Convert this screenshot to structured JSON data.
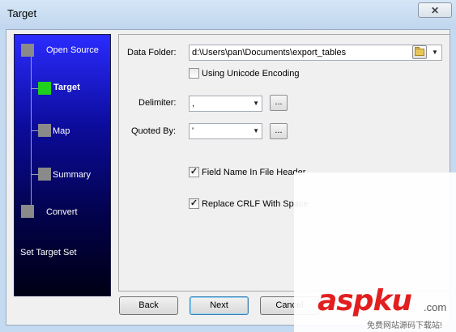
{
  "window": {
    "title": "Target",
    "close_glyph": "✕"
  },
  "wizard": {
    "steps": [
      {
        "label": "Open Source",
        "active": false
      },
      {
        "label": "Target",
        "active": true
      },
      {
        "label": "Map",
        "active": false
      },
      {
        "label": "Summary",
        "active": false
      },
      {
        "label": "Convert",
        "active": false
      }
    ],
    "status_text": "Set Target Set",
    "active_color": "#1fd01f",
    "inactive_color": "#8a8a8a"
  },
  "form": {
    "data_folder_label": "Data Folder:",
    "data_folder_value": "d:\\Users\\pan\\Documents\\export_tables",
    "unicode_label": "Using Unicode Encoding",
    "unicode_checked": "",
    "delimiter_label": "Delimiter:",
    "delimiter_value": ",",
    "quoted_label": "Quoted By:",
    "quoted_value": "'",
    "ellipsis": "...",
    "combo_arrow": "▼",
    "field_name_label": "Field Name In File Header",
    "field_name_checked": "✓",
    "crlf_label": "Replace CRLF With Space",
    "crlf_checked": "✓"
  },
  "buttons": {
    "back": "Back",
    "next": "Next",
    "cancel": "Cancel"
  },
  "watermark": {
    "logo": "aspku",
    "suffix": ".com",
    "tagline": "免费网站源码下载站!"
  }
}
